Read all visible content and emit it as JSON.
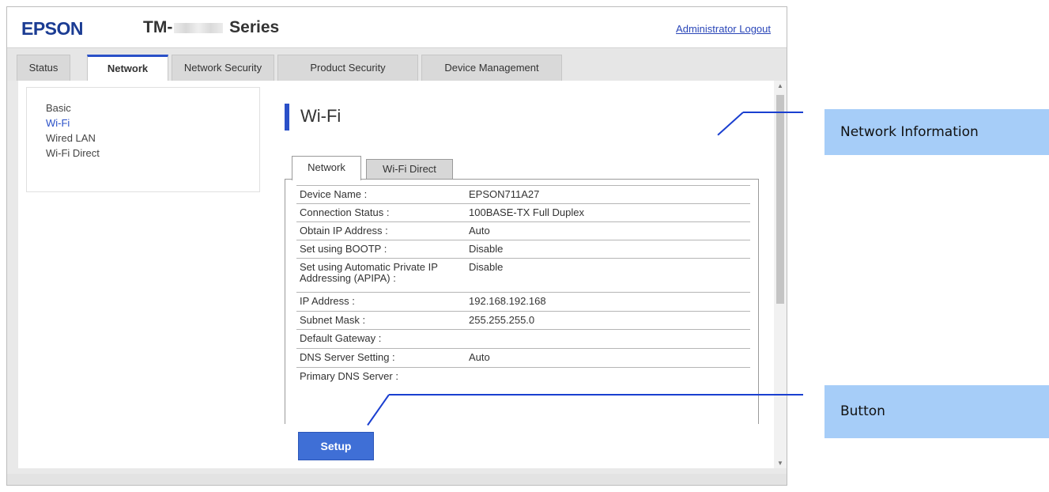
{
  "header": {
    "logo": "EPSON",
    "model_prefix": "TM-",
    "model_suffix": "Series",
    "logout_link": "Administrator Logout"
  },
  "main_tabs": [
    "Status",
    "Network",
    "Network Security",
    "Product Security",
    "Device Management"
  ],
  "sidebar": {
    "items": [
      "Basic",
      "Wi-Fi",
      "Wired LAN",
      "Wi-Fi Direct"
    ]
  },
  "page": {
    "title": "Wi-Fi",
    "sub_tabs": [
      "Network",
      "Wi-Fi Direct"
    ]
  },
  "network_info": [
    {
      "label": "Device Name :",
      "value": "EPSON711A27"
    },
    {
      "label": "Connection Status :",
      "value": "100BASE-TX Full Duplex"
    },
    {
      "label": "Obtain IP Address :",
      "value": "Auto"
    },
    {
      "label": "Set using BOOTP :",
      "value": "Disable"
    },
    {
      "label": "Set using Automatic Private IP Addressing (APIPA) :",
      "value": "Disable"
    },
    {
      "label": "IP Address :",
      "value": "192.168.192.168"
    },
    {
      "label": "Subnet Mask :",
      "value": "255.255.255.0"
    },
    {
      "label": "Default Gateway :",
      "value": ""
    },
    {
      "label": "DNS Server Setting :",
      "value": "Auto"
    },
    {
      "label": "Primary DNS Server :",
      "value": ""
    }
  ],
  "buttons": {
    "setup": "Setup"
  },
  "callouts": {
    "network_information": "Network Information",
    "button": "Button"
  },
  "colors": {
    "brand": "#1b3c93",
    "accent": "#2a50c8",
    "button": "#3f6fd6",
    "callout_bg": "#a6cdf8",
    "callout_line": "#1a3fd0"
  }
}
